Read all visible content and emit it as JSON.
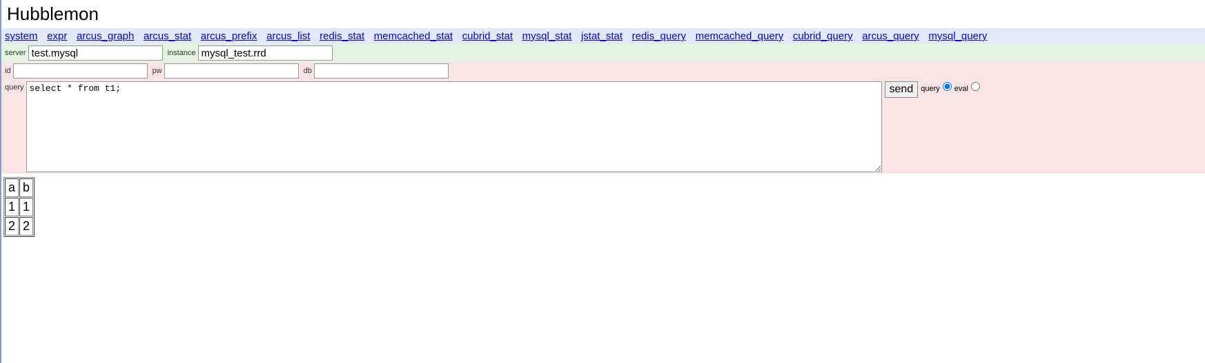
{
  "header": {
    "title": "Hubblemon"
  },
  "nav": {
    "items": [
      "system",
      "expr",
      "arcus_graph",
      "arcus_stat",
      "arcus_prefix",
      "arcus_list",
      "redis_stat",
      "memcached_stat",
      "cubrid_stat",
      "mysql_stat",
      "jstat_stat",
      "redis_query",
      "memcached_query",
      "cubrid_query",
      "arcus_query",
      "mysql_query"
    ]
  },
  "form": {
    "server_label": "server",
    "server_value": "test.mysql",
    "instance_label": "instance",
    "instance_value": "mysql_test.rrd",
    "id_label": "id",
    "id_value": "",
    "pw_label": "pw",
    "pw_value": "",
    "db_label": "db",
    "db_value": "",
    "query_label": "query",
    "query_value": "select * from t1;",
    "send_label": "send",
    "radio_query_label": "query",
    "radio_eval_label": "eval"
  },
  "result": {
    "headers": [
      "a",
      "b"
    ],
    "rows": [
      [
        "1",
        "1"
      ],
      [
        "2",
        "2"
      ]
    ]
  }
}
